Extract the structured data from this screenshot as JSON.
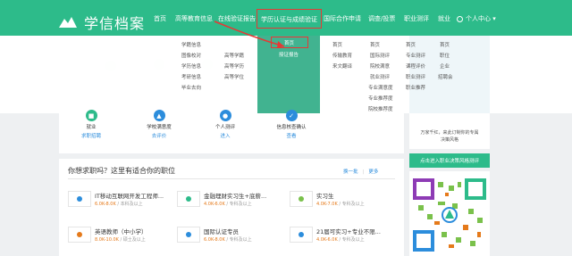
{
  "app": {
    "name": "学信档案"
  },
  "nav": {
    "items": [
      {
        "label": "首页"
      },
      {
        "label": "高等教育信息"
      },
      {
        "label": "在线验证报告"
      },
      {
        "label": "学历认证与成绩验证"
      },
      {
        "label": "国际合作申请"
      },
      {
        "label": "调查/投票"
      },
      {
        "label": "职业测评"
      },
      {
        "label": "就业"
      }
    ],
    "user": "个人中心 ▾"
  },
  "dropdown": {
    "col1": [
      "学籍信息",
      "图像校对",
      "学历信息",
      "考研信息",
      "毕业去向"
    ],
    "col2": [
      "高等学籍",
      "高等学历",
      "高等学位"
    ],
    "col3": [
      "首页",
      "授证报告"
    ],
    "col4": [
      "首页",
      "传输教育",
      "来文翻译"
    ],
    "col5": [
      "首页",
      "国际测评",
      "院校满意",
      "就业测评",
      "专业满意度",
      "专业推荐度",
      "院校推荐度"
    ],
    "col6": [
      "首页",
      "专业测评",
      "课程评价",
      "职业测评",
      "职业推荐"
    ],
    "col7": [
      "首页",
      "职位",
      "企业",
      "招聘会"
    ]
  },
  "services": [
    {
      "icon": "briefcase-icon",
      "name": "就业",
      "link": "求职招聘"
    },
    {
      "icon": "school-icon",
      "name": "学校满意度",
      "link": "去评价"
    },
    {
      "icon": "person-icon",
      "name": "个人测评",
      "link": "进入"
    },
    {
      "icon": "shield-icon",
      "name": "信息核查确认",
      "link": "查看"
    }
  ],
  "jobs": {
    "title": "你想求职吗？这里有适合你的职位",
    "refresh": "换一批",
    "more": "更多",
    "list": [
      {
        "title": "IT移动互联网开发工程师...",
        "salary": "6.0K-8.0K",
        "meta": " / 本科及以上"
      },
      {
        "title": "金融理财实习生+底薪...",
        "salary": "4.0K-6.0K",
        "meta": " / 专科及以上"
      },
      {
        "title": "实习生",
        "salary": "4.0K-7.0K",
        "meta": " / 专科及以上"
      },
      {
        "title": "英语教师（中小学）",
        "salary": "8.0K-10.0K",
        "meta": " / 硕士及以上"
      },
      {
        "title": "国际认证专员",
        "salary": "6.0K-8.0K",
        "meta": " / 专科及以上"
      },
      {
        "title": "21届可实习+专业不限...",
        "salary": "4.0K-6.0K",
        "meta": " / 专科及以上"
      }
    ]
  },
  "sidebar": {
    "promo": "万家千红，来此订制你的专属\n决策风格",
    "button": "点击进入职业决策风格测评"
  },
  "colors": {
    "brand": "#2dbb8a",
    "accent": "#e53935",
    "link": "#2c8ddc"
  }
}
